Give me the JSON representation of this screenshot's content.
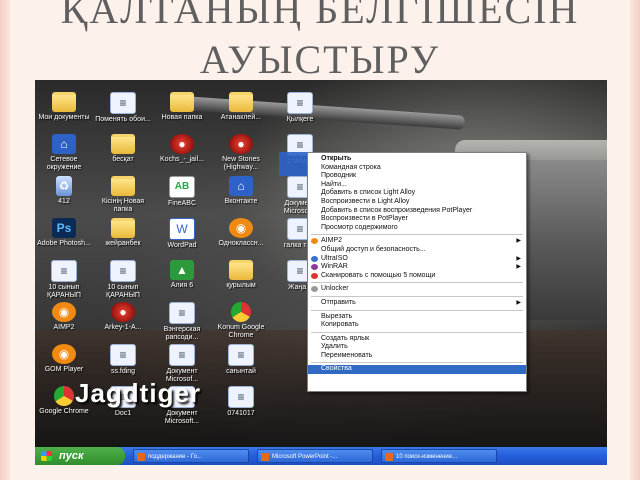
{
  "slide": {
    "title_line1": "ҚАЛТАНЫҢ БЕЛГІШЕСІН",
    "title_line2": "АУЫСТЫРУ"
  },
  "desktop": {
    "watermark": "Jagdtiger",
    "icons": [
      {
        "label": "Мои документы",
        "kind": "folder"
      },
      {
        "label": "Поменять обои...",
        "kind": "doc"
      },
      {
        "label": "Новая папка",
        "kind": "folder"
      },
      {
        "label": "Атанаклей...",
        "kind": "folder"
      },
      {
        "label": "Қылқеге",
        "kind": "doc"
      },
      {
        "label": "Сетевое окружение",
        "kind": "blue"
      },
      {
        "label": "бесқат",
        "kind": "folder"
      },
      {
        "label": "Kochs_-_jail...",
        "kind": "red"
      },
      {
        "label": "New Stones (Highway...",
        "kind": "red"
      },
      {
        "label": "слайд...",
        "kind": "doc"
      },
      {
        "label": "412",
        "kind": "bin"
      },
      {
        "label": "Кісінің Новая папка",
        "kind": "folder"
      },
      {
        "label": "FineABC",
        "kind": "ab"
      },
      {
        "label": "Вконтакте",
        "kind": "blue"
      },
      {
        "label": "Документ Microsof...",
        "kind": "doc"
      },
      {
        "label": "Adobe Photosh...",
        "kind": "ps"
      },
      {
        "label": "жейранбек",
        "kind": "folder"
      },
      {
        "label": "WordPad",
        "kind": "word"
      },
      {
        "label": "Одноклассн...",
        "kind": "orange"
      },
      {
        "label": "галка та...",
        "kind": "doc"
      },
      {
        "label": "10 сынып ҚАРАНЫП",
        "kind": "doc"
      },
      {
        "label": "10 сынып ҚАРАНЫП",
        "kind": "doc"
      },
      {
        "label": "Алия 6",
        "kind": "green"
      },
      {
        "label": "қурылым",
        "kind": "folder"
      },
      {
        "label": "Жаңа...",
        "kind": "doc"
      },
      {
        "label": "AIMP2",
        "kind": "orange"
      },
      {
        "label": "Arkey-1-A...",
        "kind": "red"
      },
      {
        "label": "Вэнгерская рапсоди...",
        "kind": "doc"
      },
      {
        "label": "Konum Google Chrome",
        "kind": "chrome"
      },
      {
        "label": "",
        "kind": "none"
      },
      {
        "label": "GOM Player",
        "kind": "orange"
      },
      {
        "label": "ss.fding",
        "kind": "doc"
      },
      {
        "label": "Документ Microsof...",
        "kind": "doc"
      },
      {
        "label": "сағынтай",
        "kind": "doc"
      },
      {
        "label": "",
        "kind": "none"
      },
      {
        "label": "Google Chrome",
        "kind": "chrome"
      },
      {
        "label": "Doc1",
        "kind": "doc"
      },
      {
        "label": "Документ Microsoft...",
        "kind": "doc"
      },
      {
        "label": "0741017",
        "kind": "doc"
      },
      {
        "label": "",
        "kind": "none"
      }
    ]
  },
  "context_menu": {
    "items": [
      {
        "label": "Открыть",
        "bold": true
      },
      {
        "label": "Командная строка"
      },
      {
        "label": "Проводник"
      },
      {
        "label": "Найти..."
      },
      {
        "label": "Добавить в список Light Alloy"
      },
      {
        "label": "Воспроизвести в Light Alloy"
      },
      {
        "label": "Добавить в список воспроизведения PotPlayer"
      },
      {
        "label": "Воспроизвести в PotPlayer"
      },
      {
        "label": "Просмотр содержимого"
      },
      {
        "sep": true
      },
      {
        "label": "AIMP2",
        "arrow": true,
        "icon": "#f08a12"
      },
      {
        "label": "Общий доступ и безопасность..."
      },
      {
        "label": "UltraISO",
        "arrow": true,
        "icon": "#3a6fd0"
      },
      {
        "label": "WinRAR",
        "arrow": true,
        "icon": "#8b3a9c"
      },
      {
        "label": "Сканировать с помощью 5 помощи",
        "icon": "#d33"
      },
      {
        "sep": true
      },
      {
        "label": "Unlocker",
        "icon": "#999"
      },
      {
        "sep": true
      },
      {
        "label": "Отправить",
        "arrow": true
      },
      {
        "sep": true
      },
      {
        "label": "Вырезать"
      },
      {
        "label": "Копировать"
      },
      {
        "sep": true
      },
      {
        "label": "Создать ярлык"
      },
      {
        "label": "Удалить"
      },
      {
        "label": "Переименовать"
      },
      {
        "sep": true
      },
      {
        "label": "Свойства",
        "selected": true
      }
    ]
  },
  "taskbar": {
    "start_label": "пуск",
    "tasks": [
      "поддержание - Го...",
      "Microsoft PowerPoint -...",
      "10 поиск-изменение..."
    ]
  }
}
